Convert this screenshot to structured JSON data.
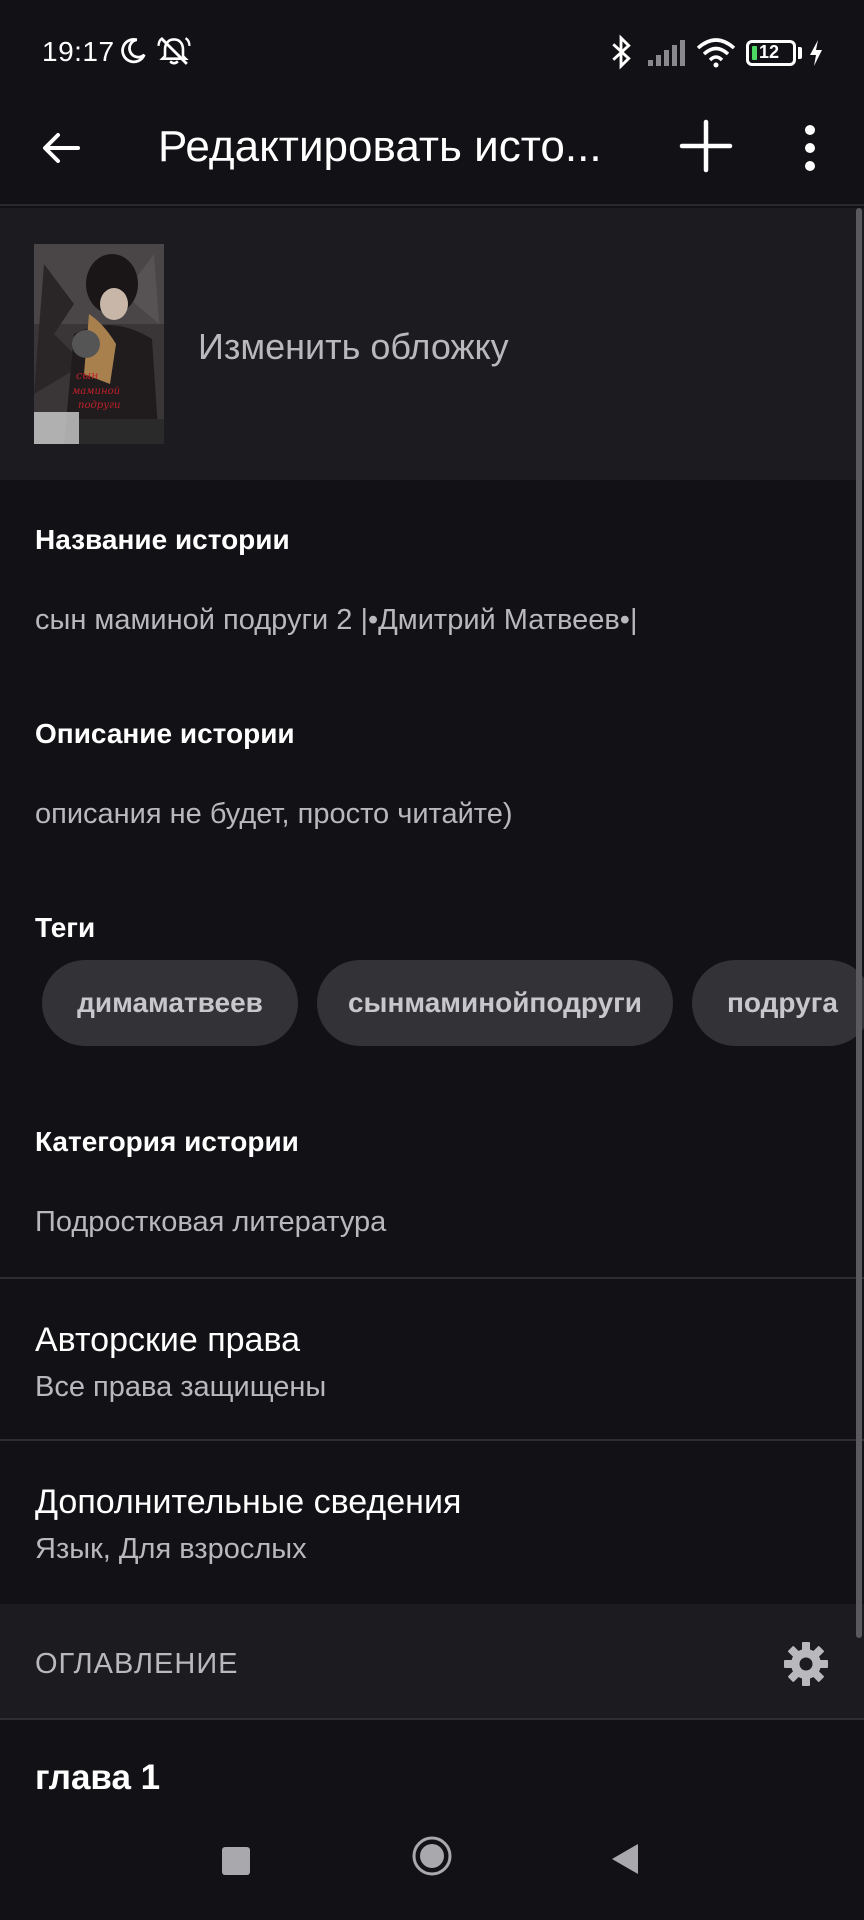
{
  "status_bar": {
    "time": "19:17",
    "battery": "12",
    "icons": [
      "moon-icon",
      "bell-off-icon",
      "bluetooth-icon",
      "signal-icon",
      "wifi-icon",
      "battery-icon",
      "charging-icon"
    ]
  },
  "app_bar": {
    "title": "Редактировать исто...",
    "icons": [
      "back-arrow-icon",
      "plus-icon",
      "more-vert-icon"
    ]
  },
  "cover": {
    "change_label": "Изменить обложку"
  },
  "story": {
    "title_label": "Название истории",
    "title_value": "сын маминой подруги 2 |•Дмитрий Матвеев•|",
    "description_label": "Описание истории",
    "description_value": "описания не будет, просто читайте)",
    "tags_label": "Теги",
    "tags": [
      "димаматвеев",
      "сынмаминойподруги",
      "подруга"
    ],
    "category_label": "Категория истории",
    "category_value": "Подростковая литература"
  },
  "rows": {
    "copyright_title": "Авторские права",
    "copyright_sub": "Все права защищены",
    "extra_title": "Дополнительные сведения",
    "extra_sub": "Язык, Для взрослых"
  },
  "toc": {
    "label": "ОГЛАВЛЕНИЕ",
    "chapters": [
      "глава 1"
    ]
  },
  "colors": {
    "background": "#121115",
    "surface": "#1c1b1f",
    "chip": "#333237",
    "text_secondary": "#b9b8bc"
  }
}
